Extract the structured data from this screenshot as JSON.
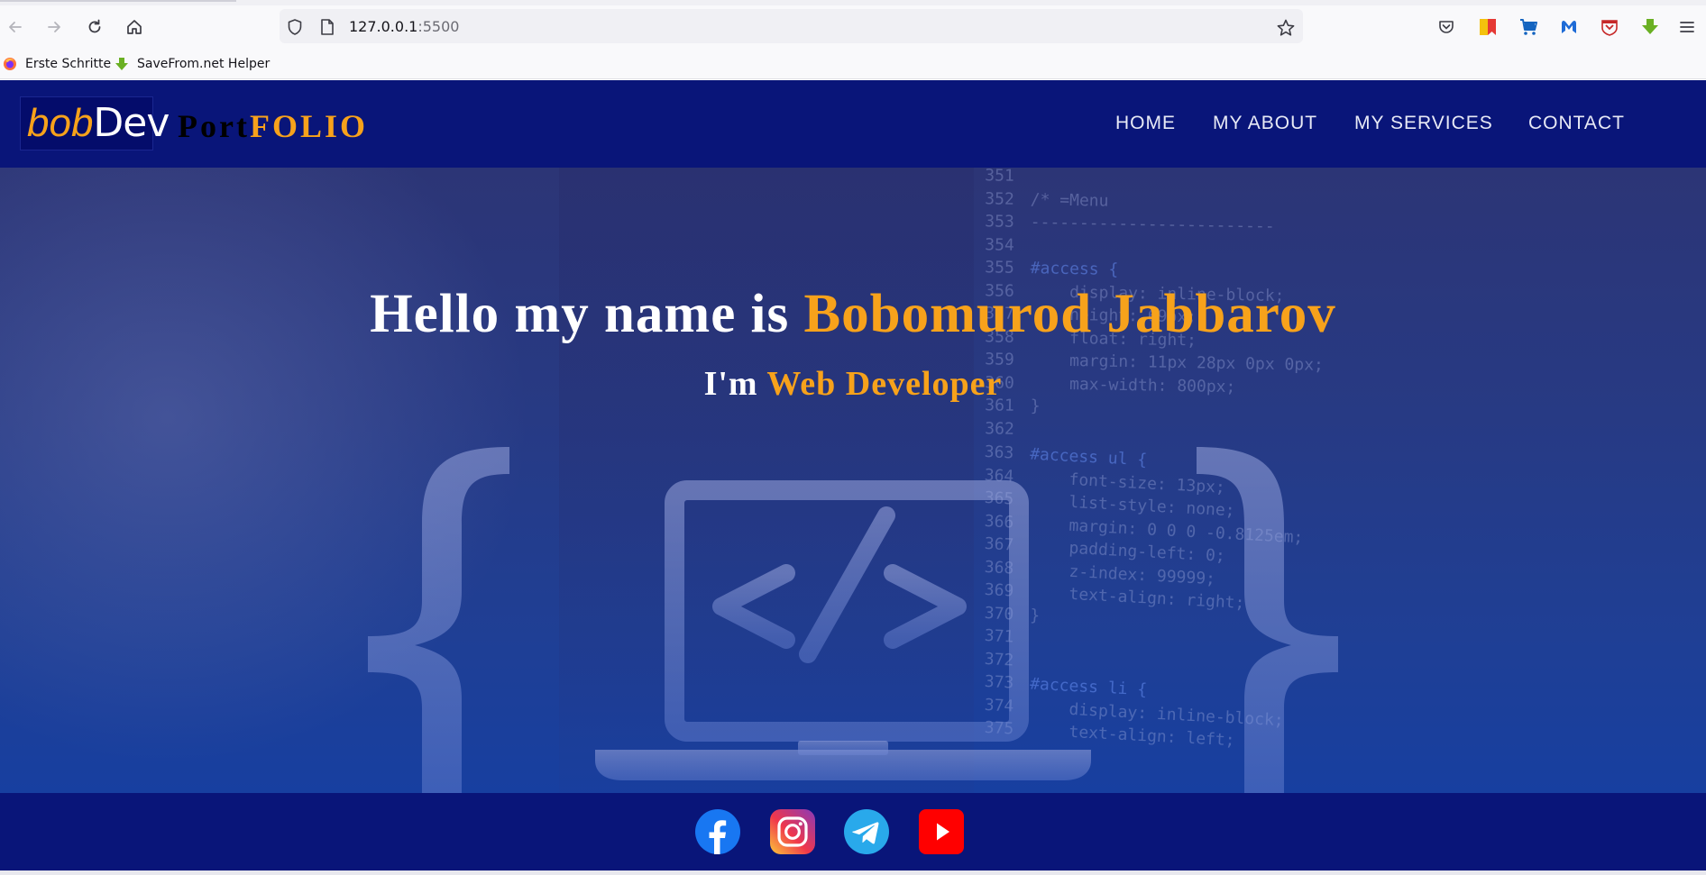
{
  "browser": {
    "url_host": "127.0.0.1",
    "url_port": ":5500",
    "toolbar_icons": [
      "back-icon",
      "forward-icon",
      "reload-icon",
      "home-icon"
    ],
    "extensions": [
      "pocket-icon",
      "bookmark-ext-icon",
      "cart-icon",
      "malwarebytes-icon",
      "mcafee-icon",
      "download-ext-icon",
      "menu-icon"
    ],
    "bookmarks": [
      {
        "label": "Erste Schritte",
        "icon": "firefox-icon"
      },
      {
        "label": "SaveFrom.net Helper",
        "icon": "savefrom-icon"
      }
    ]
  },
  "site": {
    "logo": {
      "part1": "bob",
      "part2": "Dev"
    },
    "brand": {
      "part1": "Port",
      "part2": "FOLIO"
    },
    "nav": [
      "HOME",
      "MY ABOUT",
      "MY SERVICES",
      "CONTACT"
    ],
    "hero": {
      "title_prefix": "Hello my name is ",
      "title_name": "Bobomurod Jabbarov",
      "subtitle_prefix": "I'm ",
      "subtitle_role": "Web Developer"
    },
    "code_lines": [
      {
        "n": "351",
        "t": ""
      },
      {
        "n": "352",
        "t": "/* =Menu"
      },
      {
        "n": "353",
        "t": "-------------------------"
      },
      {
        "n": "354",
        "t": ""
      },
      {
        "n": "355",
        "t": "#access {"
      },
      {
        "n": "356",
        "t": "    display: inline-block;"
      },
      {
        "n": "357",
        "t": "    height: 69px;"
      },
      {
        "n": "358",
        "t": "    float: right;"
      },
      {
        "n": "359",
        "t": "    margin: 11px 28px 0px 0px;"
      },
      {
        "n": "360",
        "t": "    max-width: 800px;"
      },
      {
        "n": "361",
        "t": "}"
      },
      {
        "n": "362",
        "t": ""
      },
      {
        "n": "363",
        "t": "#access ul {"
      },
      {
        "n": "364",
        "t": "    font-size: 13px;"
      },
      {
        "n": "365",
        "t": "    list-style: none;"
      },
      {
        "n": "366",
        "t": "    margin: 0 0 0 -0.8125em;"
      },
      {
        "n": "367",
        "t": "    padding-left: 0;"
      },
      {
        "n": "368",
        "t": "    z-index: 99999;"
      },
      {
        "n": "369",
        "t": "    text-align: right;"
      },
      {
        "n": "370",
        "t": "}"
      },
      {
        "n": "371",
        "t": ""
      },
      {
        "n": "372",
        "t": ""
      },
      {
        "n": "373",
        "t": "#access li {"
      },
      {
        "n": "374",
        "t": "    display: inline-block;"
      },
      {
        "n": "375",
        "t": "    text-align: left;"
      }
    ],
    "social": [
      "facebook-icon",
      "instagram-icon",
      "telegram-icon",
      "youtube-icon"
    ]
  },
  "colors": {
    "header_bg": "#091579",
    "accent": "#f7a21b",
    "hero_bg": "#273a84"
  }
}
